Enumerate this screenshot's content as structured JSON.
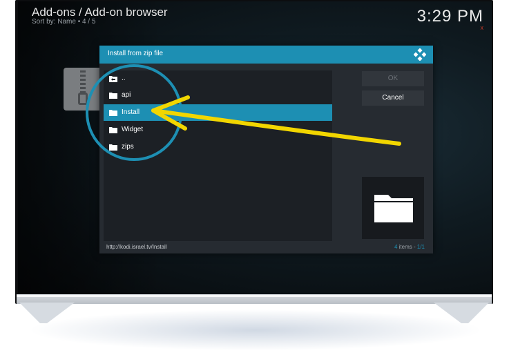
{
  "header": {
    "title": "Add-ons / Add-on browser",
    "sort": "Sort by: Name  •  4 / 5",
    "clock": "3:29 PM",
    "mute_icon": "x"
  },
  "dialog": {
    "title": "Install from zip file",
    "logo_icon": "kodi-logo-icon",
    "items": [
      {
        "label": "..",
        "icon": "parent-folder-icon"
      },
      {
        "label": "api",
        "icon": "folder-icon"
      },
      {
        "label": "Install",
        "icon": "folder-icon",
        "selected": true
      },
      {
        "label": "Widget",
        "icon": "folder-icon"
      },
      {
        "label": "zips",
        "icon": "folder-icon"
      }
    ],
    "buttons": {
      "ok": "OK",
      "cancel": "Cancel"
    },
    "footer_path": "http://kodi.israel.tv/Install",
    "footer_count_num": "4",
    "footer_count_text": " items - ",
    "footer_page": "1/1"
  },
  "colors": {
    "accent": "#1d8fb3",
    "annotation_arrow": "#f2d600",
    "annotation_circle": "#1d8fb3"
  }
}
